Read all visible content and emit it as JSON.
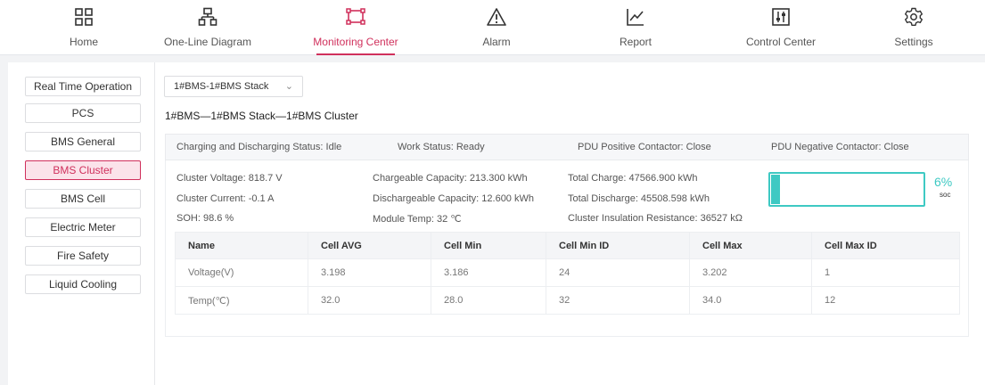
{
  "nav": [
    {
      "label": "Home"
    },
    {
      "label": "One-Line Diagram"
    },
    {
      "label": "Monitoring Center"
    },
    {
      "label": "Alarm"
    },
    {
      "label": "Report"
    },
    {
      "label": "Control Center"
    },
    {
      "label": "Settings"
    }
  ],
  "accent_color": "#d0305c",
  "soc_color": "#3ec9c3",
  "sidebar": [
    {
      "label": "Real Time Operation"
    },
    {
      "label": "PCS"
    },
    {
      "label": "BMS General"
    },
    {
      "label": "BMS Cluster"
    },
    {
      "label": "BMS Cell"
    },
    {
      "label": "Electric Meter"
    },
    {
      "label": "Fire Safety"
    },
    {
      "label": "Liquid Cooling"
    }
  ],
  "selector": {
    "value": "1#BMS-1#BMS Stack"
  },
  "cluster_title": "1#BMS—1#BMS Stack—1#BMS Cluster",
  "status": {
    "charging": "Charging and Discharging Status: Idle",
    "work": "Work Status: Ready",
    "pdu_pos": "PDU Positive Contactor: Close",
    "pdu_neg": "PDU Negative Contactor: Close"
  },
  "stats": {
    "voltage": "Cluster Voltage: 818.7 V",
    "current": "Cluster Current: -0.1 A",
    "soh": "SOH: 98.6 %",
    "chargeable": "Chargeable Capacity: 213.300 kWh",
    "dischargeable": "Dischargeable Capacity: 12.600 kWh",
    "module_temp": "Module Temp: 32 ℃",
    "total_charge": "Total Charge: 47566.900 kWh",
    "total_discharge": "Total Discharge: 45508.598 kWh",
    "insulation": "Cluster Insulation Resistance: 36527 kΩ"
  },
  "soc": {
    "percent": 6,
    "value_text": "6%",
    "label": "soc"
  },
  "cell_table": {
    "headers": [
      "Name",
      "Cell AVG",
      "Cell Min",
      "Cell Min ID",
      "Cell Max",
      "Cell Max ID"
    ],
    "rows": [
      [
        "Voltage(V)",
        "3.198",
        "3.186",
        "24",
        "3.202",
        "1"
      ],
      [
        "Temp(℃)",
        "32.0",
        "28.0",
        "32",
        "34.0",
        "12"
      ]
    ]
  }
}
